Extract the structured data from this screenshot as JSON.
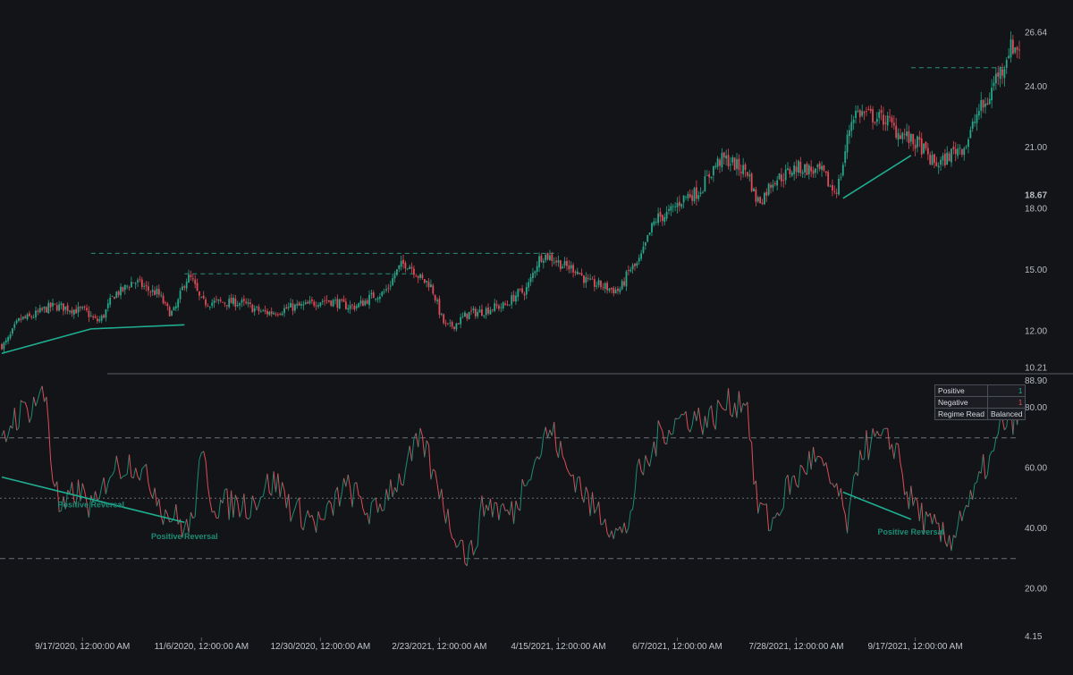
{
  "chart_data": [
    {
      "type": "candlestick",
      "title": "",
      "price_ticks": [
        26.64,
        24.0,
        21.0,
        18.67,
        18.0,
        15.0,
        12.0,
        10.21
      ],
      "last_price": 18.67,
      "ylim": [
        10.21,
        26.64
      ],
      "anchors": [
        [
          0,
          11.3
        ],
        [
          10,
          12.6
        ],
        [
          25,
          13.2
        ],
        [
          38,
          13.0
        ],
        [
          45,
          12.5
        ],
        [
          55,
          13.9
        ],
        [
          62,
          14.4
        ],
        [
          72,
          13.9
        ],
        [
          80,
          12.9
        ],
        [
          88,
          14.6
        ],
        [
          95,
          13.4
        ],
        [
          110,
          13.4
        ],
        [
          125,
          12.9
        ],
        [
          140,
          13.2
        ],
        [
          152,
          13.5
        ],
        [
          165,
          13.2
        ],
        [
          178,
          13.8
        ],
        [
          190,
          15.3
        ],
        [
          200,
          14.4
        ],
        [
          210,
          12.2
        ],
        [
          222,
          12.9
        ],
        [
          235,
          13.2
        ],
        [
          245,
          13.9
        ],
        [
          255,
          15.7
        ],
        [
          268,
          15.1
        ],
        [
          278,
          14.3
        ],
        [
          290,
          14.0
        ],
        [
          297,
          15.1
        ],
        [
          310,
          17.6
        ],
        [
          325,
          18.7
        ],
        [
          340,
          20.4
        ],
        [
          350,
          19.9
        ],
        [
          356,
          18.4
        ],
        [
          365,
          19.5
        ],
        [
          375,
          20.0
        ],
        [
          385,
          19.8
        ],
        [
          392,
          18.9
        ],
        [
          402,
          22.7
        ],
        [
          415,
          22.4
        ],
        [
          423,
          21.7
        ],
        [
          430,
          21.2
        ],
        [
          440,
          20.2
        ],
        [
          452,
          21.0
        ],
        [
          462,
          23.0
        ],
        [
          470,
          24.7
        ],
        [
          475,
          25.9
        ]
      ],
      "swing_lines": [
        [
          [
            0,
            10.9
          ],
          [
            42,
            12.1
          ],
          [
            86,
            12.3
          ]
        ],
        [
          [
            396,
            18.5
          ],
          [
            428,
            20.6
          ]
        ]
      ],
      "resistance_lines": [
        {
          "x": [
            42,
            262
          ],
          "value": 15.8
        },
        {
          "x": [
            86,
            195
          ],
          "value": 14.8
        },
        {
          "x": [
            428,
            472
          ],
          "value": 24.9
        }
      ],
      "bull_color": "#26a68a",
      "bear_color": "#e04b57"
    },
    {
      "type": "line",
      "title": "",
      "oscillator_ticks": [
        88.9,
        80.0,
        60.0,
        40.0,
        20.0,
        4.15
      ],
      "ylim": [
        4.15,
        88.9
      ],
      "levels": {
        "upper": 70,
        "middle": 50,
        "lower": 30
      },
      "anchors": [
        [
          0,
          68
        ],
        [
          6,
          77
        ],
        [
          13,
          80
        ],
        [
          18,
          84
        ],
        [
          21,
          83
        ],
        [
          24,
          58
        ],
        [
          28,
          45
        ],
        [
          35,
          52
        ],
        [
          44,
          47
        ],
        [
          52,
          60
        ],
        [
          62,
          62
        ],
        [
          70,
          55
        ],
        [
          78,
          45
        ],
        [
          88,
          40
        ],
        [
          95,
          62
        ],
        [
          100,
          48
        ],
        [
          115,
          48
        ],
        [
          128,
          55
        ],
        [
          140,
          45
        ],
        [
          150,
          42
        ],
        [
          162,
          53
        ],
        [
          175,
          45
        ],
        [
          185,
          55
        ],
        [
          198,
          68
        ],
        [
          205,
          55
        ],
        [
          212,
          40
        ],
        [
          220,
          31
        ],
        [
          228,
          48
        ],
        [
          240,
          45
        ],
        [
          250,
          62
        ],
        [
          258,
          72
        ],
        [
          268,
          58
        ],
        [
          280,
          46
        ],
        [
          292,
          38
        ],
        [
          302,
          60
        ],
        [
          312,
          73
        ],
        [
          322,
          77
        ],
        [
          332,
          76
        ],
        [
          342,
          81
        ],
        [
          350,
          83
        ],
        [
          356,
          48
        ],
        [
          362,
          42
        ],
        [
          372,
          55
        ],
        [
          382,
          63
        ],
        [
          392,
          54
        ],
        [
          398,
          42
        ],
        [
          405,
          67
        ],
        [
          412,
          69
        ],
        [
          420,
          68
        ],
        [
          428,
          49
        ],
        [
          438,
          40
        ],
        [
          445,
          36
        ],
        [
          455,
          48
        ],
        [
          465,
          62
        ],
        [
          472,
          75
        ],
        [
          478,
          77
        ]
      ],
      "divergence_lines": [
        [
          [
            0,
            57
          ],
          [
            86,
            42
          ]
        ],
        [
          [
            396,
            52
          ],
          [
            428,
            43
          ]
        ]
      ],
      "annotations": [
        {
          "text": "Positive Reversal",
          "x": 42,
          "y": 47
        },
        {
          "text": "Positive Reversal",
          "x": 86,
          "y": 36.5
        },
        {
          "text": "Positive Reversal",
          "x": 428,
          "y": 38
        }
      ],
      "up_color": "#1b8c76",
      "down_color": "#e04b57"
    }
  ],
  "x_axis": {
    "bars": 480,
    "labels": [
      {
        "text": "9/17/2020, 12:00:00 AM",
        "bar": 38
      },
      {
        "text": "11/6/2020, 12:00:00 AM",
        "bar": 94
      },
      {
        "text": "12/30/2020, 12:00:00 AM",
        "bar": 150
      },
      {
        "text": "2/23/2021, 12:00:00 AM",
        "bar": 206
      },
      {
        "text": "4/15/2021, 12:00:00 AM",
        "bar": 262
      },
      {
        "text": "6/7/2021, 12:00:00 AM",
        "bar": 318
      },
      {
        "text": "7/28/2021, 12:00:00 AM",
        "bar": 374
      },
      {
        "text": "9/17/2021, 12:00:00 AM",
        "bar": 430
      }
    ]
  },
  "regime_table": {
    "rows": [
      {
        "label": "Positive",
        "value": "1",
        "tone": "pos"
      },
      {
        "label": "Negative",
        "value": "1",
        "tone": "neg"
      },
      {
        "label": "Regime Read",
        "value": "Balanced",
        "tone": ""
      }
    ]
  }
}
